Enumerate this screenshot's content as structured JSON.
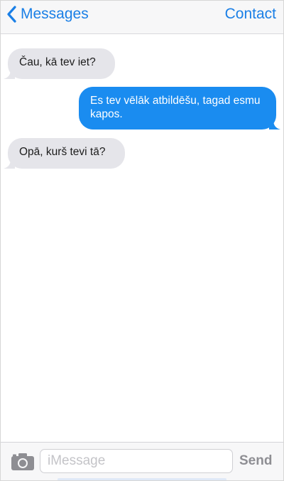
{
  "header": {
    "back_label": "Messages",
    "back_icon": "chevron-left-icon",
    "contact_label": "Contact",
    "accent_color": "#1a7fe6"
  },
  "messages": [
    {
      "direction": "incoming",
      "text": "Čau, kā tev iet?"
    },
    {
      "direction": "outgoing",
      "text": "Es tev vēlāk atbildēšu, tagad esmu kapos."
    },
    {
      "direction": "incoming",
      "text": "Opā, kurš tevi tā?"
    }
  ],
  "input_bar": {
    "camera_icon": "camera-icon",
    "placeholder": "iMessage",
    "value": "",
    "send_label": "Send"
  },
  "colors": {
    "incoming_bubble": "#e5e5ea",
    "outgoing_bubble": "#1a8cf0",
    "send_disabled": "#8e8e93"
  }
}
